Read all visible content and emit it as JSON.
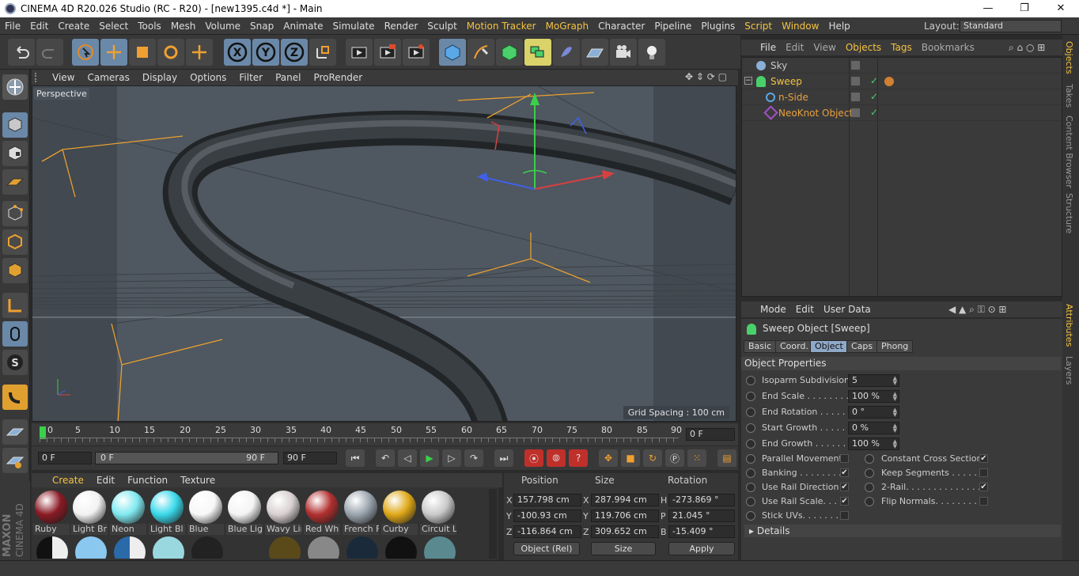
{
  "window": {
    "title": "CINEMA 4D R20.026 Studio (RC - R20) - [new1395.c4d *] - Main",
    "min": "—",
    "max": "❐",
    "close": "✕"
  },
  "menubar": {
    "items": [
      "File",
      "Edit",
      "Create",
      "Select",
      "Tools",
      "Mesh",
      "Volume",
      "Snap",
      "Animate",
      "Simulate",
      "Render",
      "Sculpt",
      "Motion Tracker",
      "MoGraph",
      "Character",
      "Pipeline",
      "Plugins",
      "Script",
      "Window",
      "Help"
    ],
    "layout_label": "Layout:",
    "layout_value": "Standard"
  },
  "viewport": {
    "menu": [
      "View",
      "Cameras",
      "Display",
      "Options",
      "Filter",
      "Panel",
      "ProRender"
    ],
    "camera_label": "Perspective",
    "grid_spacing": "Grid Spacing : 100 cm"
  },
  "timeline": {
    "ticks": [
      "0",
      "5",
      "10",
      "15",
      "20",
      "25",
      "30",
      "35",
      "40",
      "45",
      "50",
      "55",
      "60",
      "65",
      "70",
      "75",
      "80",
      "85",
      "90"
    ],
    "current_frame": "0 F"
  },
  "playbar": {
    "start": "0 F",
    "range_start": "0 F",
    "range_end": "90 F",
    "end": "90 F"
  },
  "materials": {
    "menu": [
      "Create",
      "Edit",
      "Function",
      "Texture"
    ],
    "items": [
      {
        "name": "Ruby",
        "color": "#8a1a24"
      },
      {
        "name": "Light Br",
        "color": "#f2f2f2"
      },
      {
        "name": "Neon",
        "color": "#7fe9f0"
      },
      {
        "name": "Light Bl",
        "color": "#39d8ea"
      },
      {
        "name": "Blue",
        "color": "#f7f7f7"
      },
      {
        "name": "Blue Lig",
        "color": "#f4f4f4"
      },
      {
        "name": "Wavy Lir",
        "color": "#d8d0d0"
      },
      {
        "name": "Red Wh",
        "color": "#b23030"
      },
      {
        "name": "French F",
        "color": "#9aa4ae"
      },
      {
        "name": "Curby",
        "color": "#e0a818"
      },
      {
        "name": "Circuit L",
        "color": "#c9c9c9"
      }
    ]
  },
  "coords": {
    "headers": [
      "Position",
      "Size",
      "Rotation"
    ],
    "rows": [
      {
        "axis": "X",
        "pos": "157.798 cm",
        "saxis": "X",
        "size": "287.994 cm",
        "raxis": "H",
        "rot": "-273.869 °"
      },
      {
        "axis": "Y",
        "pos": "-100.93 cm",
        "saxis": "Y",
        "size": "119.706 cm",
        "raxis": "P",
        "rot": "21.045 °"
      },
      {
        "axis": "Z",
        "pos": "-116.864 cm",
        "saxis": "Z",
        "size": "309.652 cm",
        "raxis": "B",
        "rot": "-15.409 °"
      }
    ],
    "mode": "Object (Rel)",
    "size_mode": "Size",
    "apply": "Apply"
  },
  "objects": {
    "menu": [
      "File",
      "Edit",
      "View",
      "Objects",
      "Tags",
      "Bookmarks"
    ],
    "items": [
      {
        "name": "Sky",
        "color": "#c8c8c8",
        "indent": 0
      },
      {
        "name": "Sweep",
        "color": "#f5c342",
        "indent": 0
      },
      {
        "name": "n-Side",
        "color": "#e8a040",
        "indent": 1
      },
      {
        "name": "NeoKnot Object",
        "color": "#e8a040",
        "indent": 1
      }
    ]
  },
  "right_tabs": [
    "Objects",
    "Takes",
    "Content Browser",
    "Structure",
    "Attributes",
    "Layers"
  ],
  "attributes": {
    "menu": [
      "Mode",
      "Edit",
      "User Data"
    ],
    "title": "Sweep Object [Sweep]",
    "tabs": [
      "Basic",
      "Coord.",
      "Object",
      "Caps",
      "Phong"
    ],
    "section": "Object Properties",
    "fields": [
      {
        "label": "Isoparm Subdivision",
        "value": "5"
      },
      {
        "label": "End Scale . . . . . . . . . .",
        "value": "100 %"
      },
      {
        "label": "End Rotation . . . . . .",
        "value": "0 °"
      },
      {
        "label": "Start Growth . . . . . .",
        "value": "0 %"
      },
      {
        "label": "End Growth . . . . . . .",
        "value": "100 %"
      }
    ],
    "checks_left": [
      {
        "label": "Parallel Movement",
        "checked": ""
      },
      {
        "label": "Banking . . . . . . . . .",
        "checked": "✔"
      },
      {
        "label": "Use Rail Direction",
        "checked": "✔"
      },
      {
        "label": "Use Rail Scale. . . .",
        "checked": "✔"
      },
      {
        "label": "Stick UVs. . . . . . . .",
        "checked": ""
      }
    ],
    "checks_right": [
      {
        "label": "Constant Cross Section",
        "checked": "✔"
      },
      {
        "label": "Keep Segments . . . . . . .",
        "checked": ""
      },
      {
        "label": "2-Rail. . . . . . . . . . . . . . .",
        "checked": "✔"
      },
      {
        "label": "Flip Normals. . . . . . . . . .",
        "checked": ""
      }
    ],
    "details": "Details"
  },
  "maxon": {
    "brand": "MAXON",
    "product": "CINEMA 4D"
  }
}
